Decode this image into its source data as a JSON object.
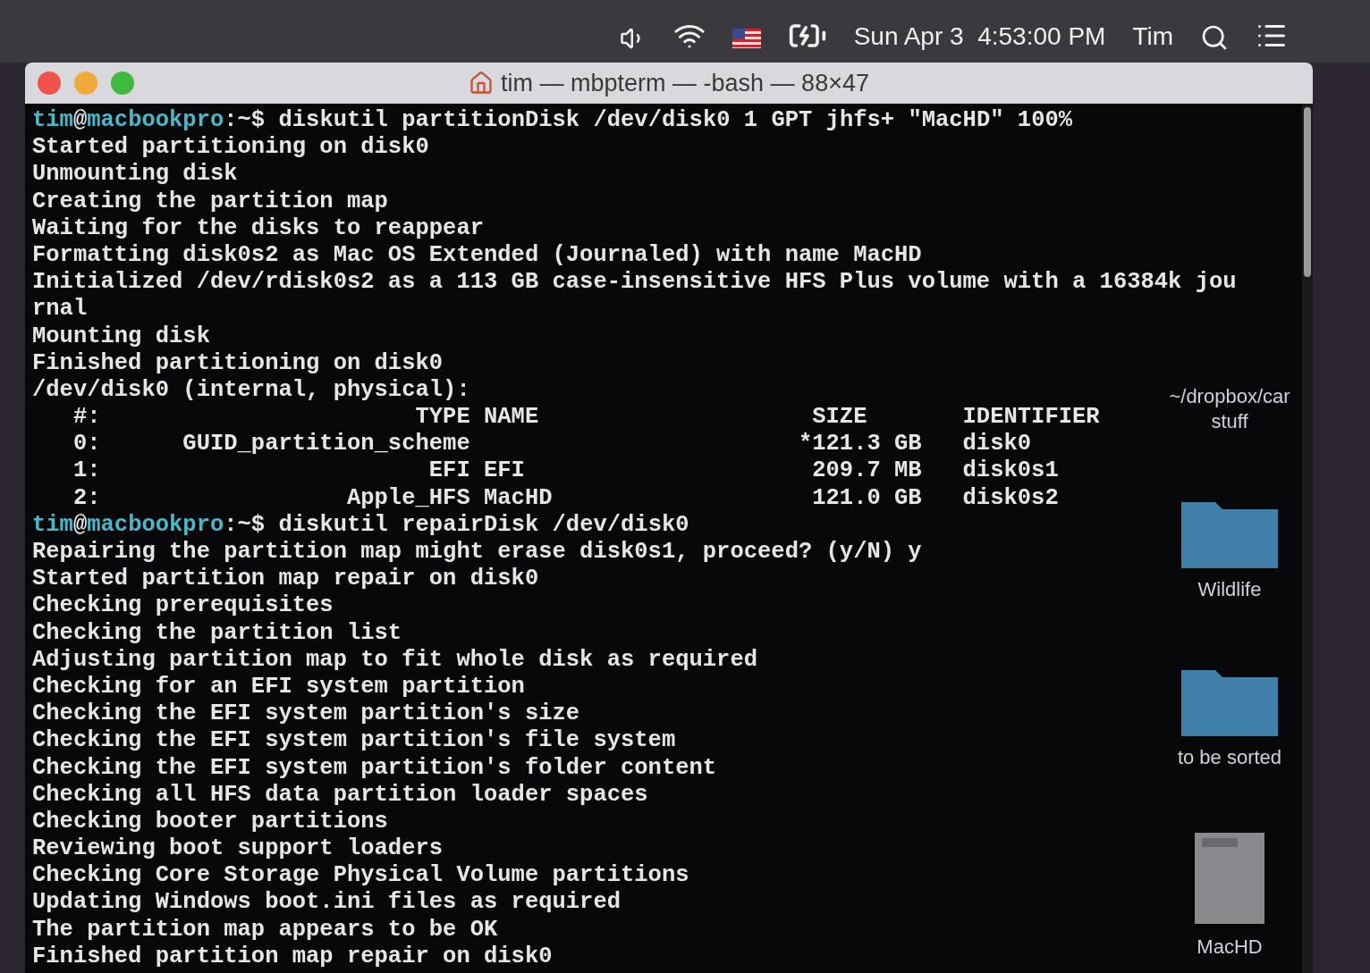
{
  "menu_bar": {
    "date_time": "Sun Apr 3  4:53:00 PM",
    "user": "Tim"
  },
  "window": {
    "title": "tim — mbpterm — -bash — 88×47"
  },
  "terminal": {
    "lines": [
      {
        "kind": "prompt",
        "user": "tim",
        "at": "@",
        "host": "macbookpro",
        "tail": ":~$",
        "command": "diskutil partitionDisk /dev/disk0 1 GPT jhfs+ \"MacHD\" 100%"
      },
      {
        "kind": "output",
        "text": "Started partitioning on disk0"
      },
      {
        "kind": "output",
        "text": "Unmounting disk"
      },
      {
        "kind": "output",
        "text": "Creating the partition map"
      },
      {
        "kind": "output",
        "text": "Waiting for the disks to reappear"
      },
      {
        "kind": "output",
        "text": "Formatting disk0s2 as Mac OS Extended (Journaled) with name MacHD"
      },
      {
        "kind": "output",
        "text": "Initialized /dev/rdisk0s2 as a 113 GB case-insensitive HFS Plus volume with a 16384k jou"
      },
      {
        "kind": "output",
        "text": "rnal"
      },
      {
        "kind": "output",
        "text": "Mounting disk"
      },
      {
        "kind": "output",
        "text": "Finished partitioning on disk0"
      },
      {
        "kind": "output",
        "text": "/dev/disk0 (internal, physical):"
      },
      {
        "kind": "output",
        "text": "   #:                       TYPE NAME                    SIZE       IDENTIFIER"
      },
      {
        "kind": "output",
        "text": "   0:      GUID_partition_scheme                        *121.3 GB   disk0"
      },
      {
        "kind": "output",
        "text": "   1:                        EFI EFI                     209.7 MB   disk0s1"
      },
      {
        "kind": "output",
        "text": "   2:                  Apple_HFS MacHD                   121.0 GB   disk0s2"
      },
      {
        "kind": "prompt",
        "user": "tim",
        "at": "@",
        "host": "macbookpro",
        "tail": ":~$",
        "command": "diskutil repairDisk /dev/disk0"
      },
      {
        "kind": "output",
        "text": "Repairing the partition map might erase disk0s1, proceed? (y/N) y"
      },
      {
        "kind": "output",
        "text": "Started partition map repair on disk0"
      },
      {
        "kind": "output",
        "text": "Checking prerequisites"
      },
      {
        "kind": "output",
        "text": "Checking the partition list"
      },
      {
        "kind": "output",
        "text": "Adjusting partition map to fit whole disk as required"
      },
      {
        "kind": "output",
        "text": "Checking for an EFI system partition"
      },
      {
        "kind": "output",
        "text": "Checking the EFI system partition's size"
      },
      {
        "kind": "output",
        "text": "Checking the EFI system partition's file system"
      },
      {
        "kind": "output",
        "text": "Checking the EFI system partition's folder content"
      },
      {
        "kind": "output",
        "text": "Checking all HFS data partition loader spaces"
      },
      {
        "kind": "output",
        "text": "Checking booter partitions"
      },
      {
        "kind": "output",
        "text": "Reviewing boot support loaders"
      },
      {
        "kind": "output",
        "text": "Checking Core Storage Physical Volume partitions"
      },
      {
        "kind": "output",
        "text": "Updating Windows boot.ini files as required"
      },
      {
        "kind": "output",
        "text": "The partition map appears to be OK"
      },
      {
        "kind": "output",
        "text": "Finished partition map repair on disk0"
      }
    ]
  },
  "desktop": {
    "icons": [
      {
        "kind": "hidden",
        "label": "~/dropbox/car stuff"
      },
      {
        "kind": "folder",
        "label": "Wildlife"
      },
      {
        "kind": "folder",
        "label": "to be sorted"
      },
      {
        "kind": "drive",
        "label": "MacHD"
      }
    ]
  }
}
